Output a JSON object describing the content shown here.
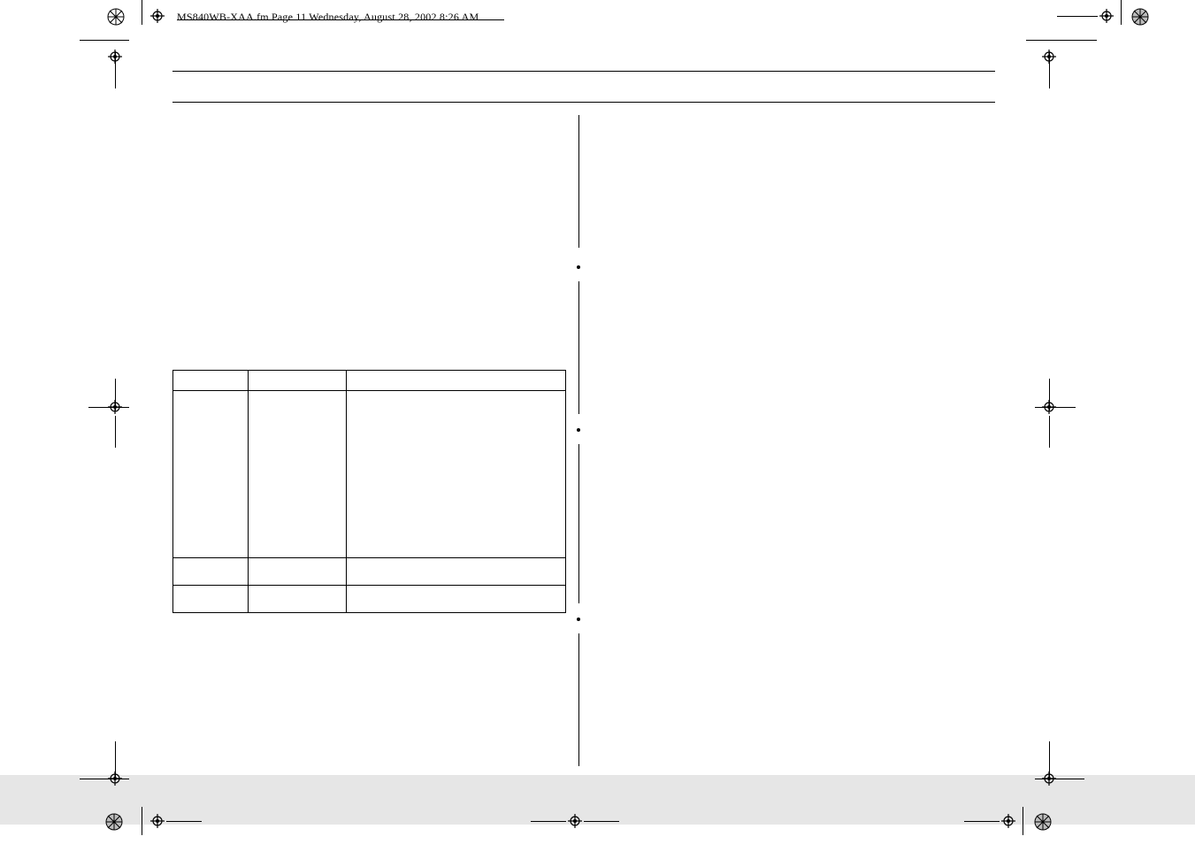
{
  "header": {
    "text": "MS840WB-XAA.fm  Page 11  Wednesday, August 28, 2002  8:26 AM"
  },
  "icons": {
    "spoke": "spoke-registration-mark",
    "reg": "crosshair-registration-mark"
  }
}
